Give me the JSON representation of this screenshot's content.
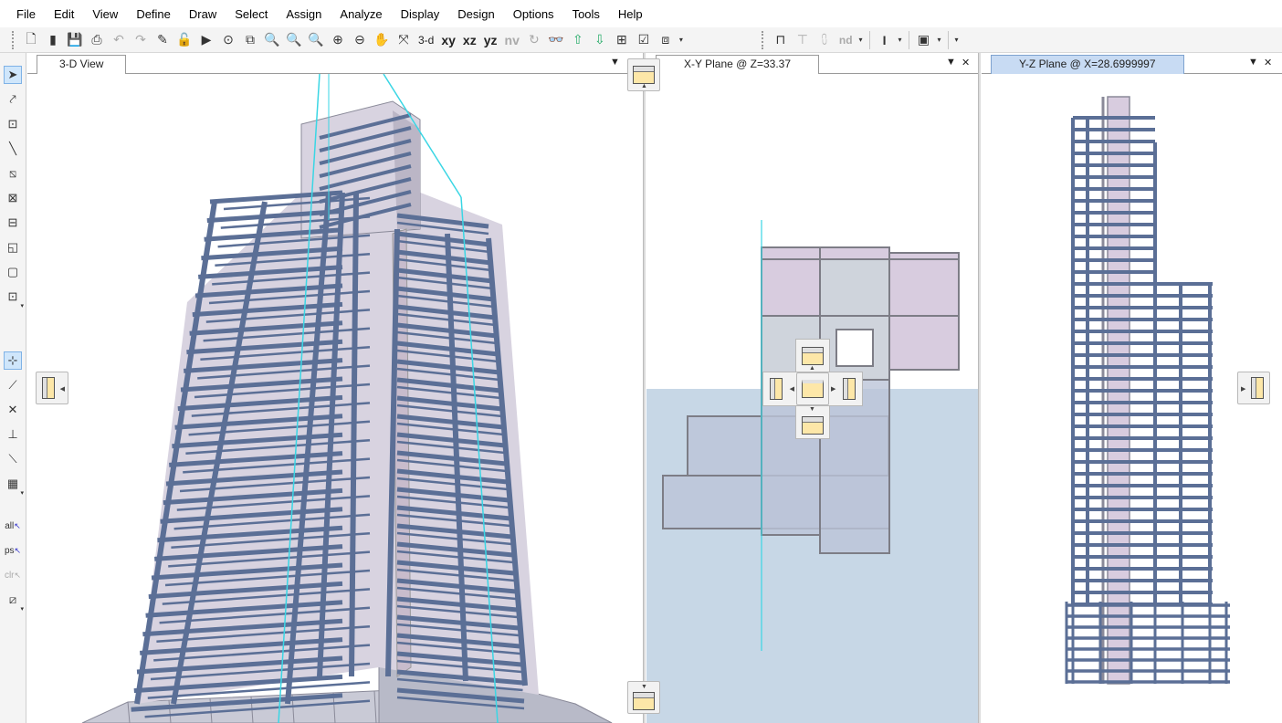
{
  "menu": [
    "File",
    "Edit",
    "View",
    "Define",
    "Draw",
    "Select",
    "Assign",
    "Analyze",
    "Display",
    "Design",
    "Options",
    "Tools",
    "Help"
  ],
  "toolbar": {
    "view_3d": "3-d",
    "view_xy": "xy",
    "view_xz": "xz",
    "view_yz": "yz",
    "view_nv": "nv",
    "nd": "nd"
  },
  "left_toolbar": {
    "select_all": "all",
    "prev_select": "ps",
    "clear_select": "clr"
  },
  "panes": {
    "view3d": {
      "title": "3-D View"
    },
    "xy": {
      "title": "X-Y Plane @ Z=33.37"
    },
    "yz": {
      "title": "Y-Z Plane @ X=28.6999997"
    }
  },
  "colors": {
    "frame": "#5b6f96",
    "area": "#d9cfe0",
    "guide": "#3ad6e4",
    "tab_active": "#c8dbf3",
    "dock_overlay": "#c7d7e6"
  },
  "icons": {
    "new": "new-file-icon",
    "open": "open-file-icon",
    "save": "save-icon",
    "print": "print-icon",
    "undo": "undo-icon",
    "redo": "redo-icon",
    "pan": "pan-hand-icon"
  }
}
